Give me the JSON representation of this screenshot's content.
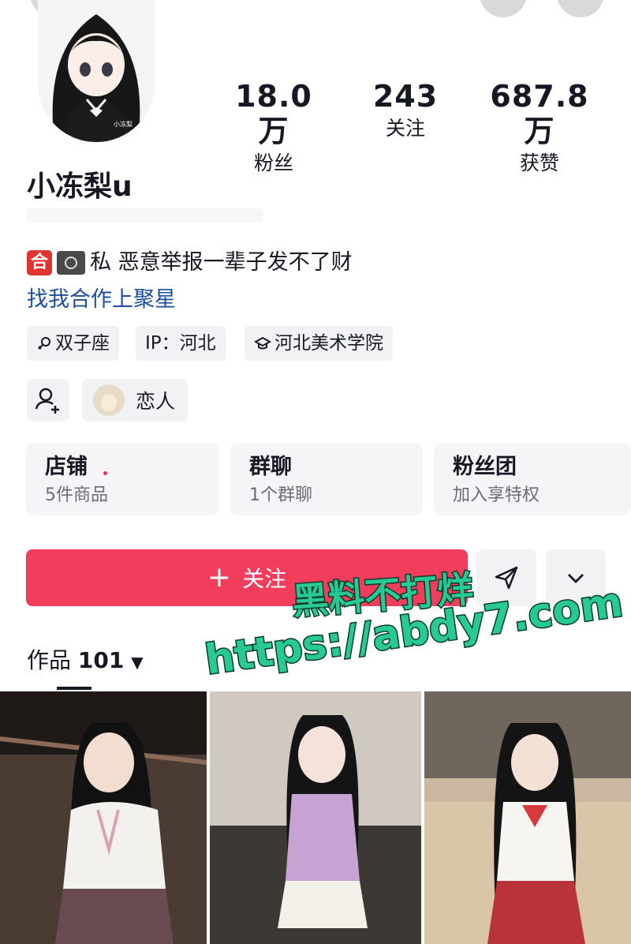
{
  "profile": {
    "name": "小冻梨u",
    "avatar_label": "小冻梨"
  },
  "stats": [
    {
      "value": "18.0万",
      "label": "粉丝"
    },
    {
      "value": "243",
      "label": "关注"
    },
    {
      "value": "687.8万",
      "label": "获赞"
    }
  ],
  "bio": {
    "badge": "合",
    "text": "私 恶意举报一辈子发不了财",
    "link": "找我合作上聚星"
  },
  "tags": {
    "zodiac": "双子座",
    "ip": "IP：河北",
    "school": "河北美术学院"
  },
  "relation": {
    "label": "恋人"
  },
  "cards": [
    {
      "title": "店铺",
      "sub": "5件商品"
    },
    {
      "title": "群聊",
      "sub": "1个群聊"
    },
    {
      "title": "粉丝团",
      "sub": "加入享特权"
    }
  ],
  "actions": {
    "follow_label": "关注"
  },
  "works": {
    "label": "作品",
    "count": "101"
  },
  "watermark": {
    "line1": "黑料不打烊",
    "line2": "https://abdy7.com"
  },
  "colors": {
    "accent": "#f23d5c",
    "link": "#1d4ea0",
    "watermark": "#28c995"
  }
}
